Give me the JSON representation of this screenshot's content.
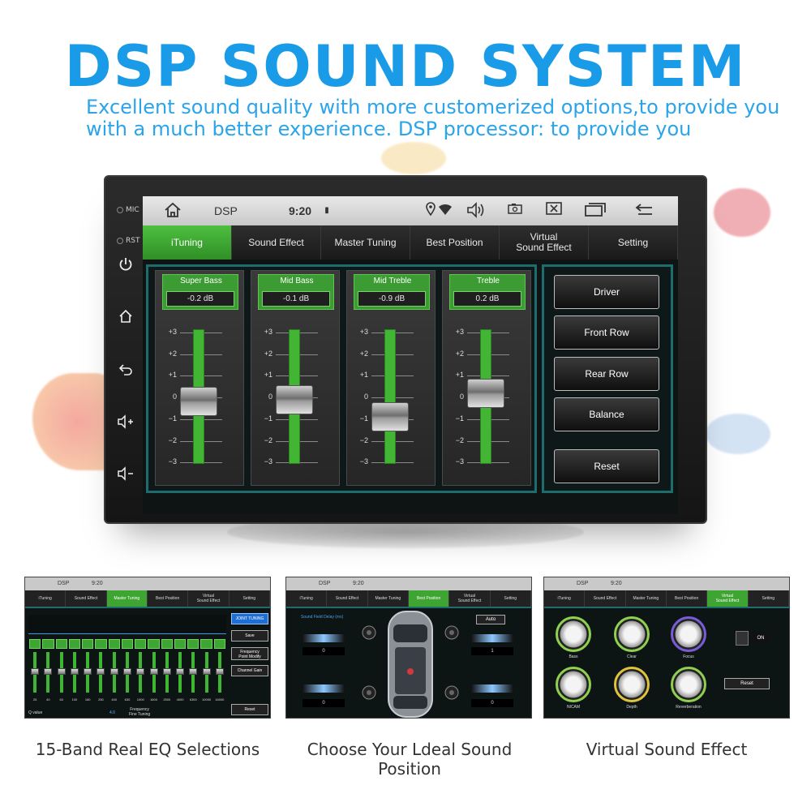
{
  "header": {
    "title": "DSP SOUND SYSTEM",
    "subtitle_line1": "Excellent sound quality with more customerized options,to provide you",
    "subtitle_line2": "with a much better experience. DSP processor: to provide you"
  },
  "device": {
    "mic_label": "MIC",
    "rst_label": "RST",
    "side_icons": [
      "power-icon",
      "home-icon",
      "back-icon",
      "volume-up-icon",
      "volume-down-icon"
    ]
  },
  "status_bar": {
    "app_name": "DSP",
    "time": "9:20",
    "icons": [
      "home-icon",
      "location-icon",
      "wifi-icon",
      "speaker-icon",
      "camera-icon",
      "close-box-icon",
      "window-icon",
      "back-arrow-icon"
    ]
  },
  "tabs": [
    {
      "label": "iTuning",
      "active": true
    },
    {
      "label": "Sound Effect",
      "active": false
    },
    {
      "label": "Master Tuning",
      "active": false
    },
    {
      "label": "Best Position",
      "active": false
    },
    {
      "label": "Virtual\nSound Effect",
      "active": false
    },
    {
      "label": "Setting",
      "active": false
    }
  ],
  "eq": {
    "ticks": [
      "+3",
      "+2",
      "+1",
      "0",
      "−1",
      "−2",
      "−3"
    ],
    "bands": [
      {
        "name": "Super Bass",
        "value": "-0.2 dB",
        "level": -0.2
      },
      {
        "name": "Mid Bass",
        "value": "-0.1 dB",
        "level": -0.1
      },
      {
        "name": "Mid Treble",
        "value": "-0.9 dB",
        "level": -0.9
      },
      {
        "name": "Treble",
        "value": "0.2 dB",
        "level": 0.2
      }
    ]
  },
  "side_buttons": [
    "Driver",
    "Front Row",
    "Rear Row",
    "Balance",
    "Reset"
  ],
  "thumbnails": [
    {
      "caption": "15-Band Real EQ Selections",
      "active_tab": 2,
      "buttons": [
        "JOINT TUNING",
        "Save",
        "Frequency\nPoint Modify",
        "Channel Gain",
        "Reset"
      ],
      "q_label": "Q value",
      "q_value": "4.0",
      "fine_label": "Frequency\nFine Tuning",
      "freqs": [
        "25",
        "40",
        "63",
        "100",
        "160",
        "250",
        "400",
        "630",
        "1000",
        "1600",
        "2500",
        "4000",
        "6300",
        "10000",
        "16000"
      ]
    },
    {
      "caption": "Choose Your Ldeal Sound Position",
      "active_tab": 3,
      "field_label": "Sound Field Delay (ms)",
      "auto_label": "Auto",
      "values": [
        "0",
        "1",
        "0",
        "0"
      ]
    },
    {
      "caption": "Virtual Sound Effect",
      "active_tab": 4,
      "knobs": [
        "Bass",
        "Clear",
        "Focus",
        "NICAM",
        "Depth",
        "Reverberation"
      ],
      "on_label": "ON",
      "reset_label": "Reset"
    }
  ],
  "thumb_tabs": [
    "iTuning",
    "Sound Effect",
    "Master Tuning",
    "Best Position",
    "Virtual\nSound Effect",
    "Setting"
  ]
}
